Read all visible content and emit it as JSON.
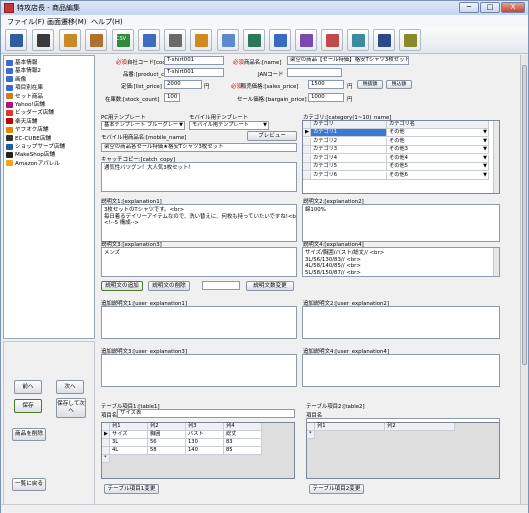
{
  "window": {
    "title": "特攻店長 - 商品編集",
    "min": "─",
    "max": "□",
    "close": "X"
  },
  "menu": [
    "ファイル(F)",
    "画面遷移(M)",
    "ヘルプ(H)"
  ],
  "toolbar": {
    "icons": [
      "list-icon",
      "grid-icon",
      "folder-icon",
      "box-icon",
      "csv-icon",
      "upload-icon",
      "screen-icon",
      "settings-icon",
      "window-icon",
      "edit-icon",
      "edit2-icon",
      "edit3-icon",
      "table-icon",
      "export-icon",
      "search-icon",
      "help-icon"
    ],
    "csv_text": "CSV"
  },
  "sidebar": {
    "items": [
      {
        "label": "基本情報",
        "color": "#3a6ccf"
      },
      {
        "label": "基本情報2",
        "color": "#3a6ccf"
      },
      {
        "label": "画像",
        "color": "#3a6ccf"
      },
      {
        "label": "項目別在庫",
        "color": "#3a6ccf"
      },
      {
        "label": "セット商品",
        "color": "#d27a1e"
      },
      {
        "label": "Yahoo!店舗",
        "color": "#b0127a"
      },
      {
        "label": "ビッダーズ店舗",
        "color": "#d53b2a"
      },
      {
        "label": "楽天店舗",
        "color": "#bf0000"
      },
      {
        "label": "ヤフオク店舗",
        "color": "#e08a00"
      },
      {
        "label": "EC-CUBE店舗",
        "color": "#333333"
      },
      {
        "label": "ショップサーブ店舗",
        "color": "#1a5fa8"
      },
      {
        "label": "MakeShop店舗",
        "color": "#222222"
      },
      {
        "label": "Amazonアパレル",
        "color": "#f3a41c"
      }
    ]
  },
  "nav": {
    "prev": "前へ",
    "next": "次へ",
    "save": "保存",
    "save_next": "保存して次へ",
    "delete": "商品を削除",
    "back_list": "一覧に戻る"
  },
  "product": {
    "required": "必須",
    "code_label": "自社コード[code]",
    "code": "T-shirt001",
    "name_label": "商品名:[name]",
    "name": "架空の商品【セール特価】格安Tシャツ3枚セット",
    "number_label": "品番:[product_code]",
    "number": "T-shirt001",
    "jan_label": "JANコード",
    "jan": "",
    "list_price_label": "定価:[list_price]",
    "list_price": "2000",
    "yen": "円",
    "sales_price_label": "販売価格:[sales_price]",
    "sales_price": "1500",
    "points_btn": "税抜額",
    "use_btn": "税込額",
    "stock_label": "在庫数:[stock_count]",
    "stock": "100",
    "bargain_label": "セール価格:[bargain_price]",
    "bargain": "1000"
  },
  "templates": {
    "pc_label": "PC用テンプレート",
    "pc_value": "基本テンプレート ブルーグレー",
    "mobile_label": "モバイル用テンプレート",
    "mobile_value": "モバイル用テンプレート",
    "mobile_name_label": "モバイル用商品名:[mobile_name]",
    "preview": "プレビュー",
    "mobile_name": "架空の商品各セール特価★格安Tシャツ3枚セット",
    "catch_label": "キャッチコピー:[catch_copy]",
    "catch": "通気性バツグン！大人気3枚セット！"
  },
  "category": {
    "label": "カテゴリ:[category(1~10)_name]",
    "col1": "カテゴリ",
    "col2": "カテゴリ名",
    "rows": [
      [
        "カテゴリ1",
        "その他"
      ],
      [
        "カテゴリ2",
        "その他"
      ],
      [
        "カテゴリ3",
        "その他3"
      ],
      [
        "カテゴリ4",
        "その他4"
      ],
      [
        "カテゴリ5",
        "その他5"
      ],
      [
        "カテゴリ6",
        "その他6"
      ]
    ]
  },
  "explanations": {
    "e1_label": "説明文1:[explanation1]",
    "e1": "3枚セットのTシャツです。<br>\n毎日着るデイリーアイテムなので、洗い替えに、何枚も持っていたいですね!<br>\n<!--5 構成-->",
    "e2_label": "説明文2:[explanation2]",
    "e2": "綿100%",
    "e3_label": "説明文3:[explanation3]",
    "e3": "メンズ",
    "e4_label": "説明文4:[explanation4]",
    "e4": "サイズ/胸囲/バスト/総丈// <br>\n3L/56/130/83// <br>\n4L/58/140/85// <br>\n5L/58/150/87// <br>",
    "add_btn": "説明文の追加",
    "del_btn": "説明文の削除",
    "change_btn": "説明文数変更",
    "u1_label": "追加説明文1:[user_explanation1]",
    "u2_label": "追加説明文2:[user_explanation2]",
    "u3_label": "追加説明文3:[user_explanation3]",
    "u4_label": "追加説明文4:[user_explanation4]"
  },
  "tables": {
    "t1_label": "テーブル項目1:[table1]",
    "t1_name_label": "項目名",
    "t1_name": "サイズ表",
    "t1_cols": [
      "列1",
      "列2",
      "列3",
      "列4"
    ],
    "t1_rows": [
      [
        "サイズ",
        "胸囲",
        "バスト",
        "総丈"
      ],
      [
        "3L",
        "56",
        "130",
        "83"
      ],
      [
        "4L",
        "58",
        "140",
        "85"
      ]
    ],
    "t1_btn": "テーブル項目1変更",
    "t2_label": "テーブル項目2:[table2]",
    "t2_name_label": "項目名",
    "t2_name": "",
    "t2_cols": [
      "列1",
      "列2"
    ],
    "t2_btn": "テーブル項目2変更"
  }
}
